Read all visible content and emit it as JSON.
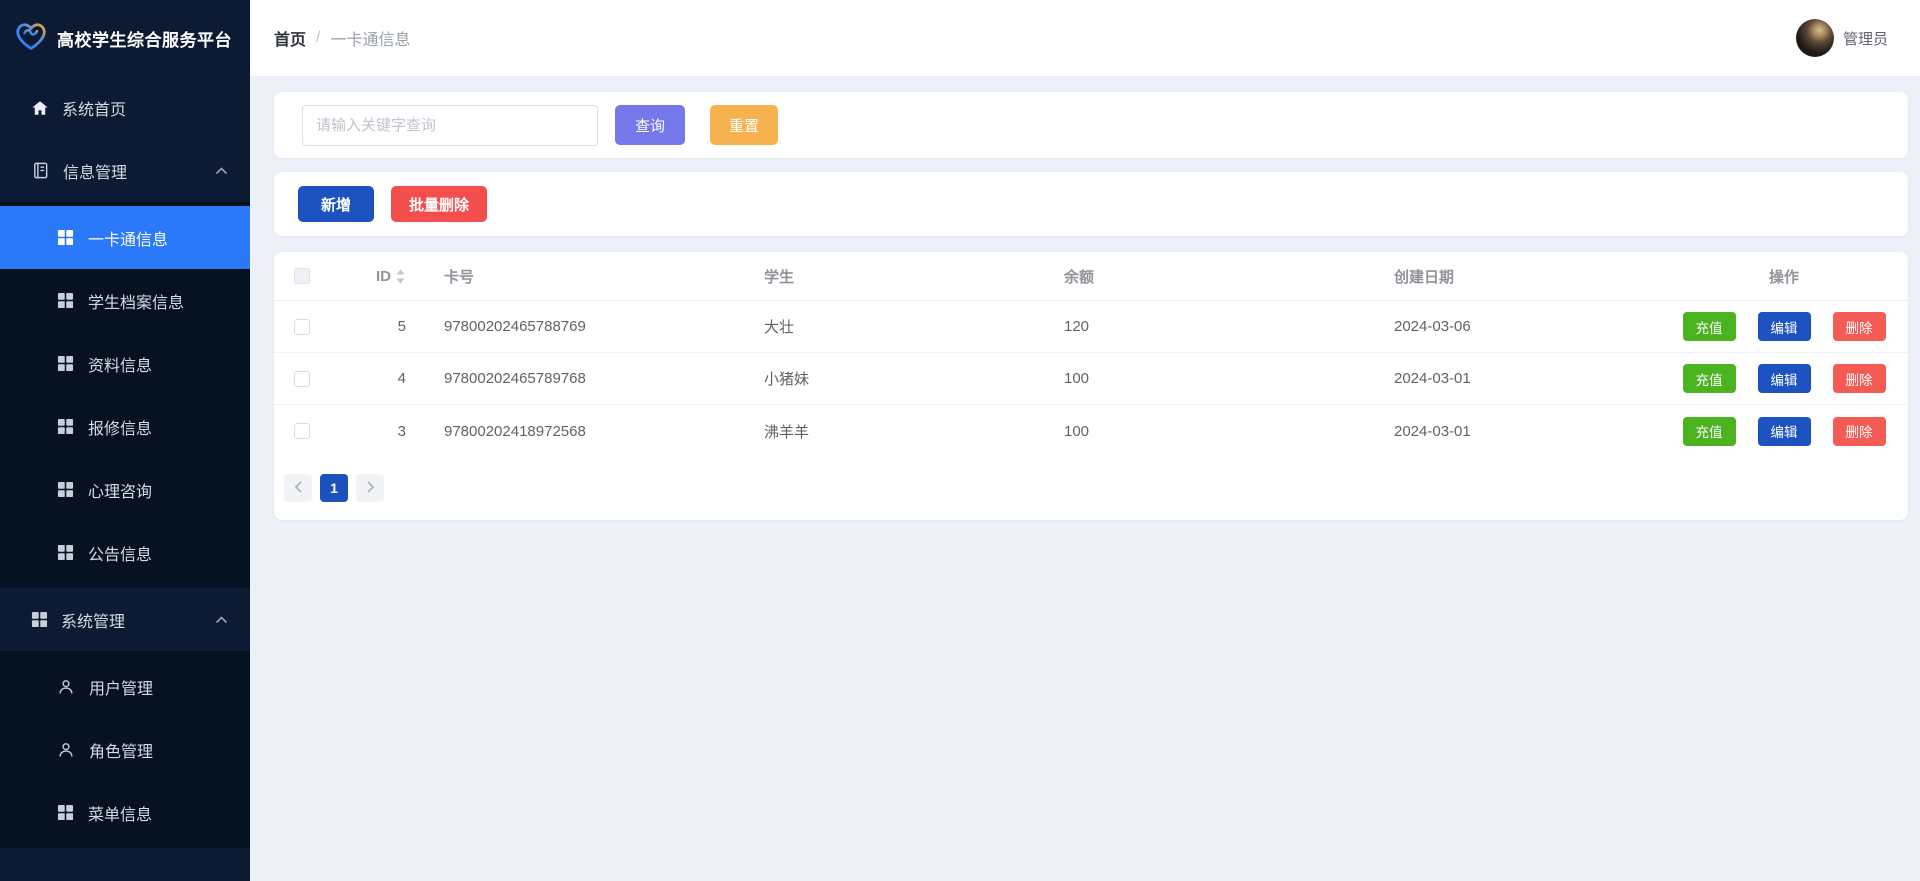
{
  "app": {
    "title": "高校学生综合服务平台"
  },
  "header": {
    "breadcrumb": [
      "首页",
      "一卡通信息"
    ],
    "breadcrumb_separator": "/",
    "user": "管理员"
  },
  "sidebar": {
    "items": [
      {
        "label": "系统首页",
        "icon": "home-icon"
      },
      {
        "label": "信息管理",
        "icon": "notebook-icon",
        "expanded": true,
        "children": [
          {
            "label": "一卡通信息",
            "icon": "grid-icon",
            "active": true
          },
          {
            "label": "学生档案信息",
            "icon": "grid-icon"
          },
          {
            "label": "资料信息",
            "icon": "grid-icon"
          },
          {
            "label": "报修信息",
            "icon": "grid-icon"
          },
          {
            "label": "心理咨询",
            "icon": "grid-icon"
          },
          {
            "label": "公告信息",
            "icon": "grid-icon"
          }
        ]
      },
      {
        "label": "系统管理",
        "icon": "grid-icon",
        "expanded": true,
        "children": [
          {
            "label": "用户管理",
            "icon": "user-icon"
          },
          {
            "label": "角色管理",
            "icon": "user-icon"
          },
          {
            "label": "菜单信息",
            "icon": "grid-icon"
          }
        ]
      }
    ]
  },
  "search": {
    "placeholder": "请输入关键字查询",
    "query_label": "查询",
    "reset_label": "重置"
  },
  "toolbar": {
    "add_label": "新增",
    "batch_delete_label": "批量删除"
  },
  "table": {
    "columns": [
      "ID",
      "卡号",
      "学生",
      "余额",
      "创建日期",
      "操作"
    ],
    "rows": [
      {
        "id": "5",
        "card_no": "97800202465788769",
        "student": "大壮",
        "balance": "120",
        "created": "2024-03-06"
      },
      {
        "id": "4",
        "card_no": "97800202465789768",
        "student": "小猪妹",
        "balance": "100",
        "created": "2024-03-01"
      },
      {
        "id": "3",
        "card_no": "97800202418972568",
        "student": "沸羊羊",
        "balance": "100",
        "created": "2024-03-01"
      }
    ],
    "actions": [
      "充值",
      "编辑",
      "删除"
    ]
  },
  "pagination": {
    "current": "1"
  },
  "colors": {
    "sidebar_bg": "#0c1b33",
    "submenu_bg": "#061222",
    "active_menu_bg": "#2979f8",
    "content_bg": "#eef0f7",
    "query_button": "#7578e9",
    "reset_button": "#f6b24e",
    "add_button": "#1d53c1",
    "batch_delete_button": "#f44d4d",
    "recharge_button": "#4bb320",
    "edit_button": "#1d53c1",
    "delete_button": "#f45b55",
    "pagination_active": "#1b51bd"
  }
}
